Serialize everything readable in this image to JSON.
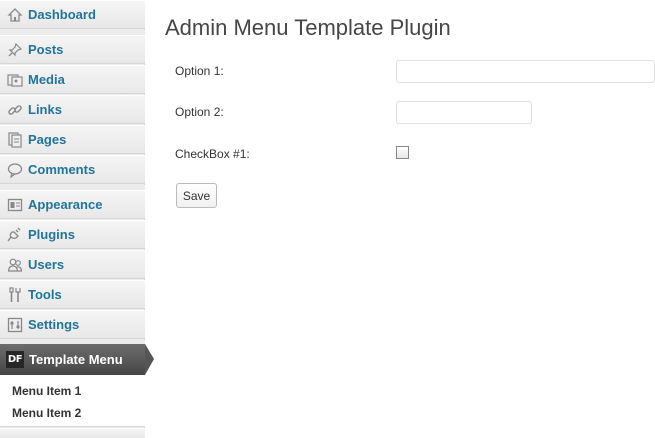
{
  "sidebar": {
    "items": [
      {
        "label": "Dashboard",
        "icon": "dashboard-icon"
      },
      {
        "label": "Posts",
        "icon": "pin-icon"
      },
      {
        "label": "Media",
        "icon": "media-icon"
      },
      {
        "label": "Links",
        "icon": "link-icon"
      },
      {
        "label": "Pages",
        "icon": "pages-icon"
      },
      {
        "label": "Comments",
        "icon": "comment-icon"
      },
      {
        "label": "Appearance",
        "icon": "appearance-icon"
      },
      {
        "label": "Plugins",
        "icon": "plug-icon"
      },
      {
        "label": "Users",
        "icon": "users-icon"
      },
      {
        "label": "Tools",
        "icon": "tools-icon"
      },
      {
        "label": "Settings",
        "icon": "settings-icon"
      }
    ],
    "active": {
      "label": "Template Menu",
      "badge": "DF"
    },
    "submenu": [
      "Menu Item 1",
      "Menu Item 2"
    ]
  },
  "main": {
    "title": "Admin Menu Template Plugin",
    "option1_label": "Option 1:",
    "option1_value": "",
    "option2_label": "Option 2:",
    "option2_value": "",
    "checkbox_label": "CheckBox #1:",
    "checkbox_checked": false,
    "save_label": "Save"
  },
  "colors": {
    "link": "#21759b",
    "active_bg": "#464646",
    "sidebar_bg": "#ececec"
  }
}
